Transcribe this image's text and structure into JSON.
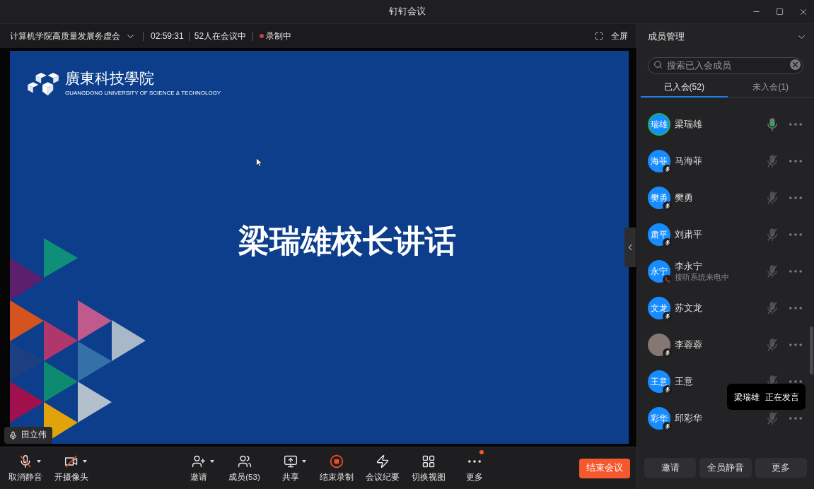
{
  "window": {
    "title": "钉钉会议"
  },
  "meeting_bar": {
    "title": "计算机学院高质量发展务虚会",
    "duration": "02:59:31",
    "participants": "52人在会议中",
    "recording": {
      "label": "录制中",
      "on": true
    },
    "fullscreen": "全屏"
  },
  "slide": {
    "logo_name": "廣東科技學院",
    "logo_subtitle": "GUANGDONG UNIVERSITY OF SCIENCE & TECHNOLOGY",
    "heading": "梁瑞雄校长讲话"
  },
  "speaker_label": {
    "name": "田立伟"
  },
  "toolbar": {
    "left": [
      {
        "kind": "mic-off",
        "label": "取消静音",
        "dropdown": true,
        "badge": false
      },
      {
        "kind": "camera-off",
        "label": "开摄像头",
        "dropdown": true,
        "badge": false
      }
    ],
    "center": [
      {
        "kind": "invite",
        "label": "邀请",
        "dropdown": true,
        "badge": false
      },
      {
        "kind": "members",
        "label": "成员(53)",
        "dropdown": false,
        "badge": false
      },
      {
        "kind": "share",
        "label": "共享",
        "dropdown": true,
        "badge": false
      },
      {
        "kind": "stop-recording",
        "label": "结束录制",
        "dropdown": false,
        "badge": false
      },
      {
        "kind": "minutes",
        "label": "会议纪要",
        "dropdown": false,
        "badge": false
      },
      {
        "kind": "layout",
        "label": "切换视图",
        "dropdown": false,
        "badge": false
      },
      {
        "kind": "more",
        "label": "更多",
        "dropdown": false,
        "badge": true
      }
    ],
    "end_button": "结束会议"
  },
  "members_panel": {
    "title": "成员管理",
    "search": {
      "placeholder": "搜索已入会成员"
    },
    "tabs": [
      {
        "label": "已入会(52)",
        "selected": true
      },
      {
        "label": "未入会(1)",
        "selected": false
      }
    ],
    "members": [
      {
        "avatar": {
          "kind": "text",
          "text": "瑞雄"
        },
        "name": "梁瑞雄",
        "speaking": true,
        "muted": false,
        "on_call": false
      },
      {
        "avatar": {
          "kind": "text",
          "text": "海菲"
        },
        "name": "马海菲",
        "speaking": false,
        "muted": true,
        "on_call": false
      },
      {
        "avatar": {
          "kind": "text",
          "text": "樊勇"
        },
        "name": "樊勇",
        "speaking": false,
        "muted": true,
        "on_call": false
      },
      {
        "avatar": {
          "kind": "text",
          "text": "肃平"
        },
        "name": "刘肃平",
        "speaking": false,
        "muted": true,
        "on_call": false
      },
      {
        "avatar": {
          "kind": "text",
          "text": "永宁"
        },
        "name": "李永宁",
        "status": "接听系统来电中",
        "speaking": false,
        "muted": true,
        "on_call": true
      },
      {
        "avatar": {
          "kind": "text",
          "text": "文龙"
        },
        "name": "苏文龙",
        "speaking": false,
        "muted": true,
        "on_call": false
      },
      {
        "avatar": {
          "kind": "photo"
        },
        "name": "李蓉蓉",
        "speaking": false,
        "muted": true,
        "on_call": false
      },
      {
        "avatar": {
          "kind": "text",
          "text": "王意"
        },
        "name": "王意",
        "speaking": false,
        "muted": true,
        "on_call": false
      },
      {
        "avatar": {
          "kind": "text",
          "text": "彩华"
        },
        "name": "邱彩华",
        "speaking": false,
        "muted": true,
        "on_call": false
      }
    ],
    "tooltip": {
      "name": "梁瑞雄",
      "status": "正在发言"
    },
    "buttons": [
      "邀请",
      "全员静音",
      "更多"
    ]
  }
}
